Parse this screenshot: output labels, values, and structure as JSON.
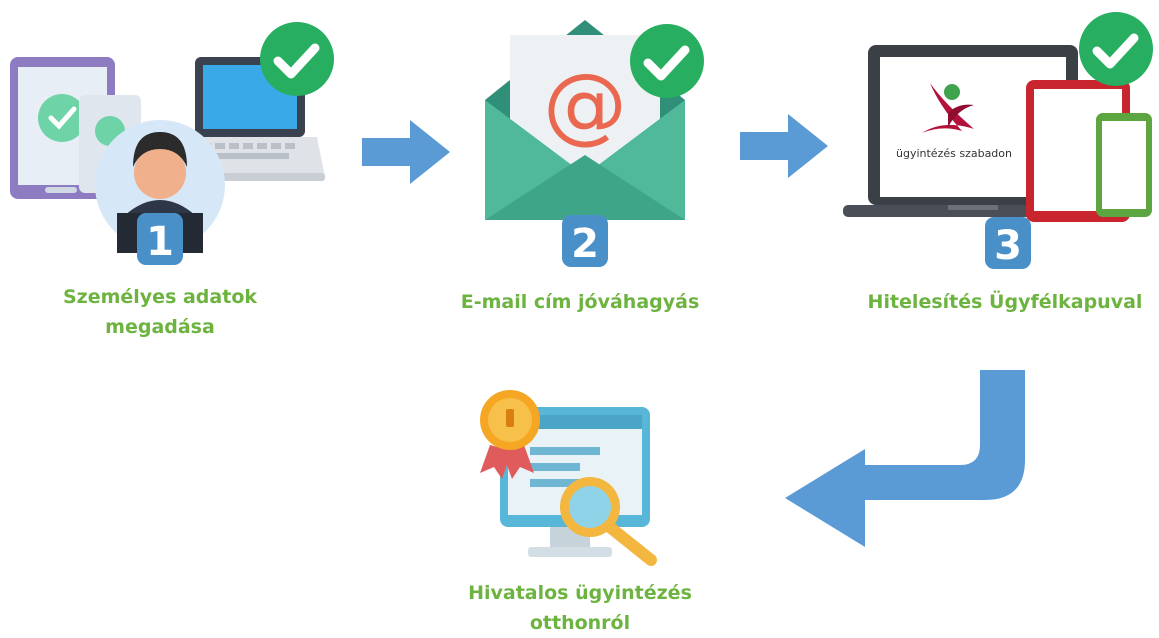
{
  "steps": [
    {
      "number": "1",
      "label_line1": "Személyes adatok",
      "label_line2": "megadása"
    },
    {
      "number": "2",
      "label": "E-mail cím jóváhagyás"
    },
    {
      "number": "3",
      "label": "Hitelesítés Ügyfélkapuval"
    }
  ],
  "final_step": {
    "label_line1": "Hivatalos ügyintézés",
    "label_line2": "otthonról"
  },
  "portal_logo_text": "ügyintézés szabadon",
  "email_symbol": "@",
  "icons": {
    "step1": "user-devices-icon",
    "step2": "email-envelope-icon",
    "step3": "laptop-devices-icon",
    "final": "certificate-monitor-icon",
    "check": "check-circle-icon",
    "arrow": "arrow-right-icon",
    "return_arrow": "return-arrow-icon"
  },
  "colors": {
    "label_green": "#6db33f",
    "check_green": "#27ae60",
    "arrow_blue": "#5b9bd5",
    "badge_blue": "#4a90c8",
    "envelope_teal": "#4fb99a",
    "portal_red": "#c8102e"
  }
}
